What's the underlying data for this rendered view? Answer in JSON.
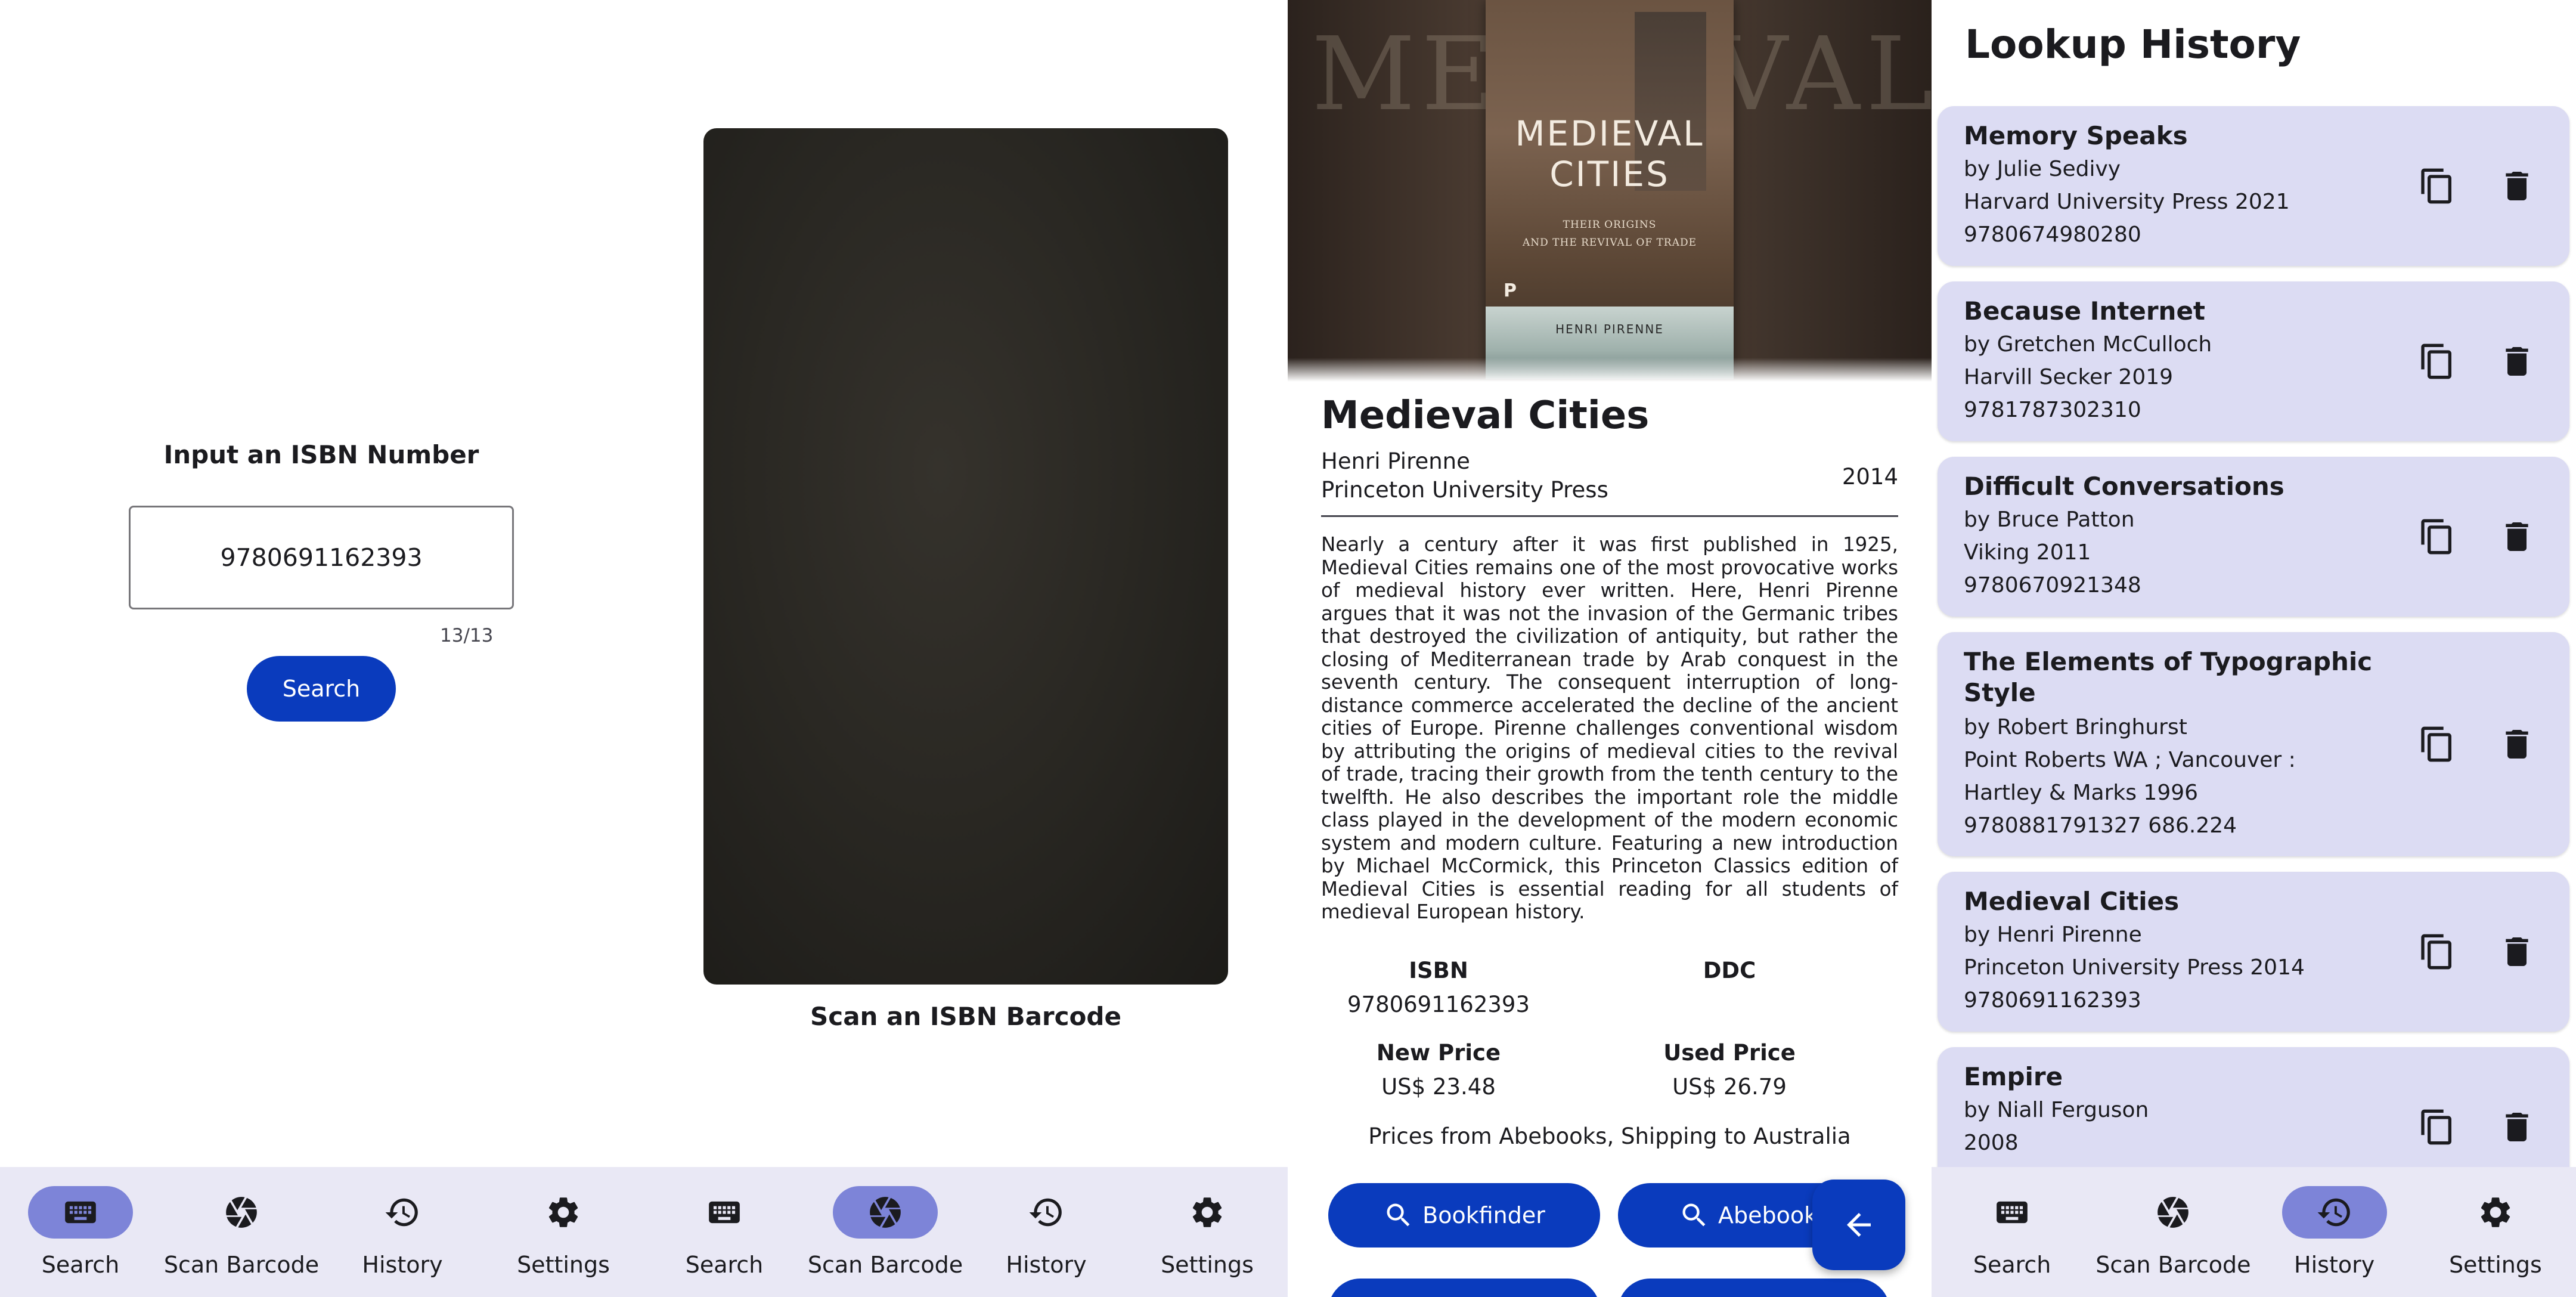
{
  "nav": {
    "items": [
      {
        "label": "Search",
        "icon": "keyboard-icon"
      },
      {
        "label": "Scan Barcode",
        "icon": "camera-shutter-icon"
      },
      {
        "label": "History",
        "icon": "history-icon"
      },
      {
        "label": "Settings",
        "icon": "gear-icon"
      }
    ]
  },
  "search_screen": {
    "prompt": "Input an ISBN Number",
    "isbn_value": "9780691162393",
    "counter": "13/13",
    "button_label": "Search"
  },
  "scan_screen": {
    "caption": "Scan an ISBN Barcode"
  },
  "detail_screen": {
    "cover": {
      "title_line1": "MEDIEVAL",
      "title_line2": "CITIES",
      "subtitle_line1": "THEIR ORIGINS",
      "subtitle_line2": "AND THE REVIVAL OF TRADE",
      "author": "HENRI PIRENNE",
      "background_text": "MEDIEVAL CITIES",
      "publisher_mark": "P"
    },
    "title": "Medieval Cities",
    "author": "Henri Pirenne",
    "publisher": "Princeton University Press",
    "year": "2014",
    "description": "Nearly a century after it was first published in 1925, Medieval Cities remains one of the most provocative works of medieval history ever written. Here, Henri Pirenne argues that it was not the invasion of the Germanic tribes that destroyed the civilization of antiquity, but rather the closing of Mediterranean trade by Arab conquest in the seventh century. The consequent interruption of long-distance commerce accelerated the decline of the ancient cities of Europe. Pirenne challenges conventional wisdom by attributing the origins of medieval cities to the revival of trade, tracing their growth from the tenth century to the twelfth. He also describes the important role the middle class played in the development of the modern economic system and modern culture. Featuring a new introduction by Michael McCormick, this Princeton Classics edition of Medieval Cities is essential reading for all students of medieval European history.",
    "isbn_label": "ISBN",
    "isbn_value": "9780691162393",
    "ddc_label": "DDC",
    "ddc_value": "",
    "new_price_label": "New Price",
    "new_price_value": "US$ 23.48",
    "used_price_label": "Used Price",
    "used_price_value": "US$ 26.79",
    "prices_note": "Prices from Abebooks, Shipping to Australia",
    "buttons": [
      {
        "label": "Bookfinder"
      },
      {
        "label": "Abebooks"
      }
    ]
  },
  "history_screen": {
    "heading": "Lookup History",
    "entries": [
      {
        "title": "Memory Speaks",
        "lines": [
          "by Julie Sedivy",
          "Harvard University Press 2021",
          "9780674980280"
        ]
      },
      {
        "title": "Because Internet",
        "lines": [
          "by Gretchen McCulloch",
          "Harvill Secker 2019",
          "9781787302310"
        ]
      },
      {
        "title": "Difficult Conversations",
        "lines": [
          "by Bruce Patton",
          "Viking 2011",
          "9780670921348"
        ]
      },
      {
        "title": "The Elements of Typographic Style",
        "lines": [
          "by Robert Bringhurst",
          "Point Roberts WA ; Vancouver :",
          "Hartley & Marks 1996",
          "9780881791327 686.224"
        ]
      },
      {
        "title": "Medieval Cities",
        "lines": [
          "by Henri Pirenne",
          "Princeton University Press 2014",
          "9780691162393"
        ]
      },
      {
        "title": "Empire",
        "lines": [
          "by Niall Ferguson",
          "2008"
        ]
      }
    ]
  },
  "colors": {
    "accent": "#0a3bbd",
    "nav_active": "#7d84d8",
    "nav_background": "#e9e8f5",
    "card_background": "#dcdcf3"
  }
}
